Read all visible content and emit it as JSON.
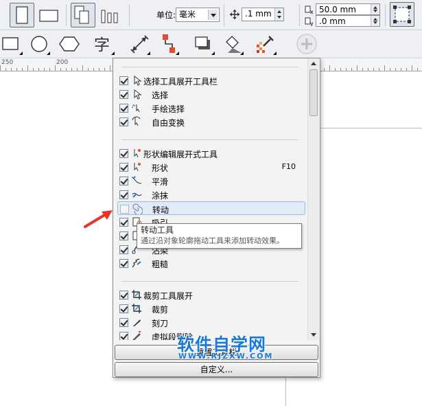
{
  "property_bar": {
    "unit_label": "单位:",
    "unit_value": "毫米",
    "nudge_value": ".1 mm",
    "dup_x": "50.0 mm",
    "dup_y": ".0 mm"
  },
  "ruler": {
    "labels": [
      "250",
      "200"
    ]
  },
  "menu": {
    "items": [
      {
        "label": "选择工具展开工具栏",
        "checked": true,
        "icon": "pick-icon"
      },
      {
        "label": "选择",
        "checked": true,
        "icon": "pick-icon"
      },
      {
        "label": "手绘选择",
        "checked": true,
        "icon": "freehand-pick-icon"
      },
      {
        "label": "自由变换",
        "checked": true,
        "icon": "free-transform-icon"
      },
      {
        "label": "形状编辑展开式工具",
        "checked": true,
        "icon": "shape-icon"
      },
      {
        "label": "形状",
        "checked": true,
        "icon": "shape-icon",
        "shortcut": "F10"
      },
      {
        "label": "平滑",
        "checked": true,
        "icon": "smooth-icon"
      },
      {
        "label": "涂抹",
        "checked": true,
        "icon": "smear-icon"
      },
      {
        "label": "转动",
        "checked": false,
        "icon": "twirl-icon"
      },
      {
        "label": "吸引",
        "checked": true,
        "icon": "attract-icon"
      },
      {
        "label": "排斥",
        "checked": true,
        "icon": "repel-icon"
      },
      {
        "label": "沾染",
        "checked": true,
        "icon": "smudge-icon"
      },
      {
        "label": "粗糙",
        "checked": true,
        "icon": "roughen-icon"
      },
      {
        "label": "裁剪工具展开",
        "checked": true,
        "icon": "crop-icon"
      },
      {
        "label": "裁剪",
        "checked": true,
        "icon": "crop-icon"
      },
      {
        "label": "刻刀",
        "checked": true,
        "icon": "knife-icon"
      },
      {
        "label": "虚拟段删除",
        "checked": true,
        "icon": "virtual-segment-delete-icon"
      }
    ],
    "reset_label": "重置工具栏",
    "customize_label": "自定义..."
  },
  "tooltip": {
    "title": "转动工具",
    "description": "通过沿对象轮廓拖动工具来添加转动效果。"
  },
  "watermark": {
    "title": "软件自学网",
    "url": "WWW.RJZXW.COM"
  },
  "colors": {
    "accent": "#1a78d9",
    "arrow": "#e8322b",
    "selection": "#e2ecf8"
  }
}
